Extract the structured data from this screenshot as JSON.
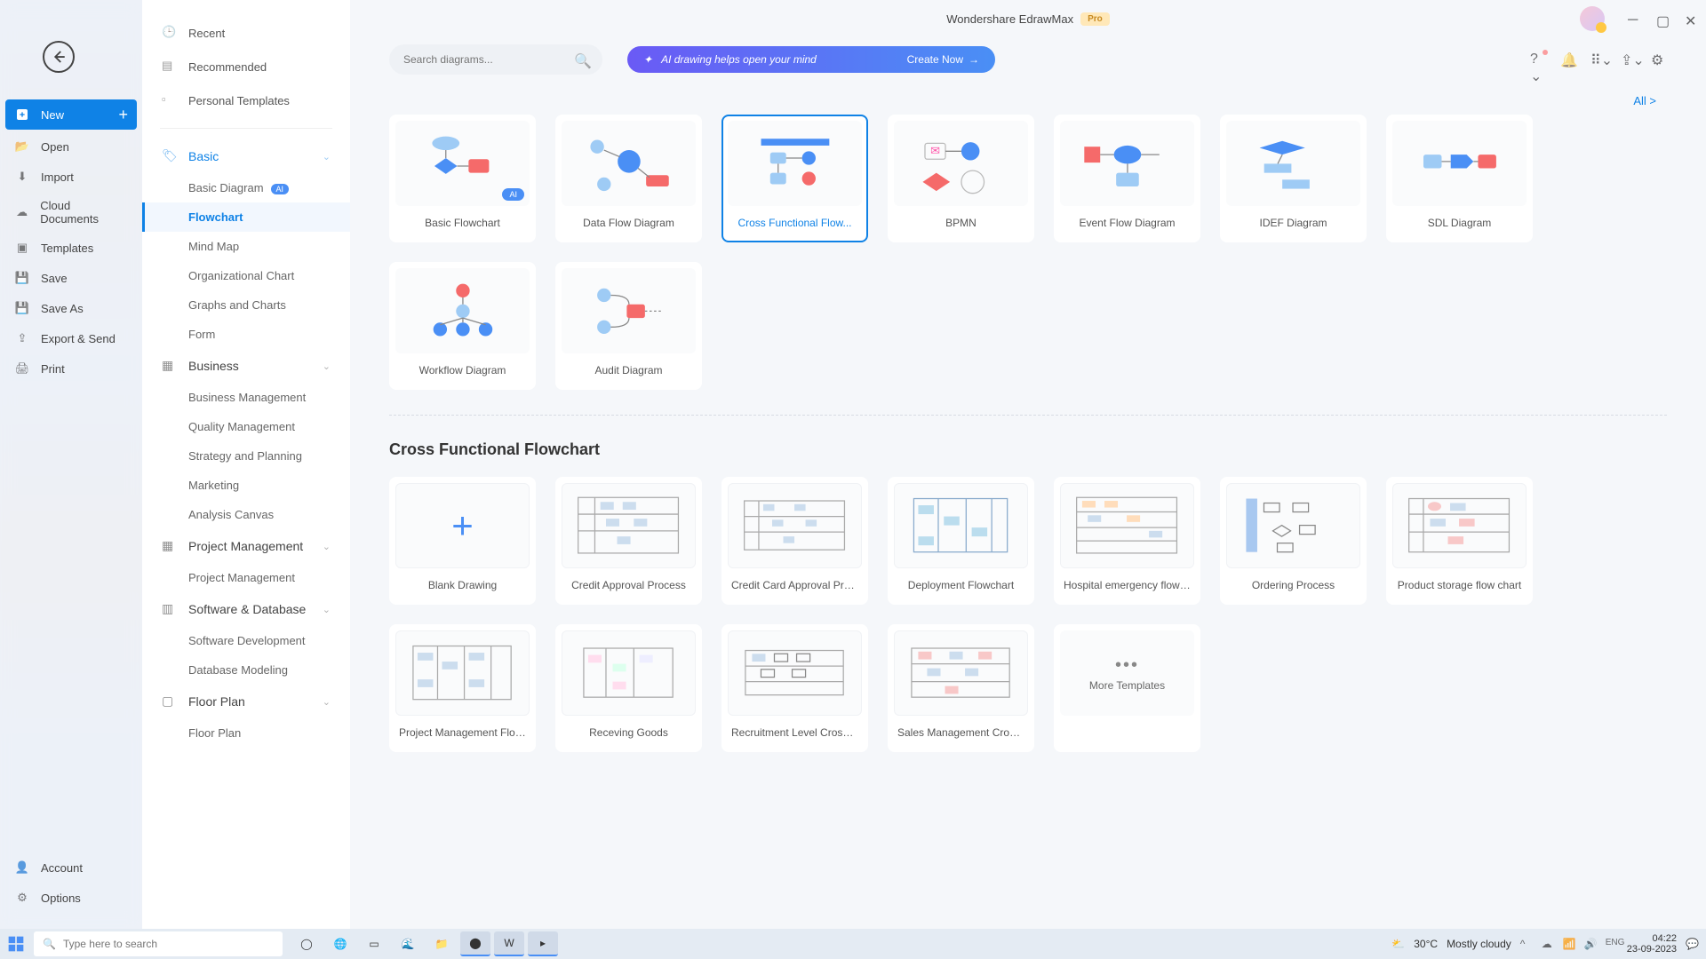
{
  "title": "Wondershare EdrawMax",
  "pro_badge": "Pro",
  "search_placeholder": "Search diagrams...",
  "ai_banner_text": "AI drawing helps open your mind",
  "ai_banner_action": "Create Now",
  "all_link": "All  >",
  "nav": {
    "new": "New",
    "open": "Open",
    "import": "Import",
    "cloud": "Cloud Documents",
    "templates": "Templates",
    "save": "Save",
    "save_as": "Save As",
    "export": "Export & Send",
    "print": "Print",
    "account": "Account",
    "options": "Options"
  },
  "cat": {
    "recent": "Recent",
    "recommended": "Recommended",
    "personal_templates": "Personal Templates",
    "basic": "Basic",
    "basic_diagram": "Basic Diagram",
    "flowchart": "Flowchart",
    "mind_map": "Mind Map",
    "org_chart": "Organizational Chart",
    "graphs": "Graphs and Charts",
    "form": "Form",
    "business": "Business",
    "biz_mgmt": "Business Management",
    "quality": "Quality Management",
    "strategy": "Strategy and Planning",
    "marketing": "Marketing",
    "analysis": "Analysis Canvas",
    "proj_mgmt": "Project Management",
    "proj_mgmt_sub": "Project Management",
    "software_db": "Software & Database",
    "software_dev": "Software Development",
    "db_model": "Database Modeling",
    "floor_plan": "Floor Plan",
    "floor_plan_sub": "Floor Plan"
  },
  "cards": [
    "Basic Flowchart",
    "Data Flow Diagram",
    "Cross Functional Flow...",
    "BPMN",
    "Event Flow Diagram",
    "IDEF Diagram",
    "SDL Diagram",
    "Workflow Diagram",
    "Audit Diagram"
  ],
  "section_title": "Cross Functional Flowchart",
  "templates": [
    "Blank Drawing",
    "Credit Approval Process",
    "Credit Card Approval Proc...",
    "Deployment Flowchart",
    "Hospital emergency flow c...",
    "Ordering Process",
    "Product storage flow chart",
    "Project Management Flow...",
    "Receving Goods",
    "Recruitment Level Cross F...",
    "Sales Management Crossf..."
  ],
  "more_templates": "More Templates",
  "taskbar": {
    "search_placeholder": "Type here to search",
    "weather_temp": "30°C",
    "weather_text": "Mostly cloudy",
    "time": "04:22",
    "date": "23-09-2023"
  }
}
